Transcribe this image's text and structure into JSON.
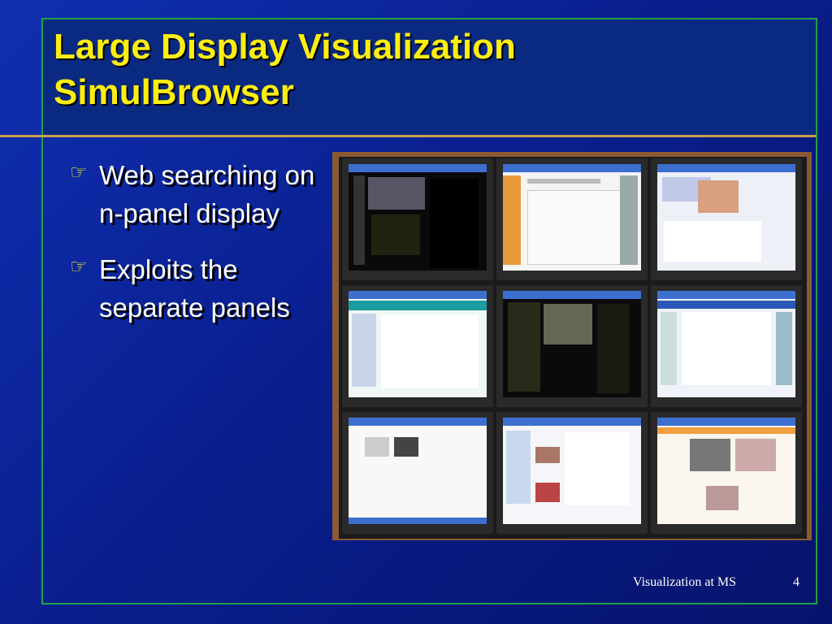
{
  "slide": {
    "title_line1": "Large Display Visualization",
    "title_line2": "SimulBrowser",
    "bullets": [
      {
        "icon": "pointing-hand-icon",
        "text": "Web searching on n-panel display"
      },
      {
        "icon": "pointing-hand-icon",
        "text": "Exploits the separate panels"
      }
    ],
    "footer": "Visualization at MS",
    "page_number": "4"
  },
  "colors": {
    "title": "#ffee10",
    "background": "#0a1f8f",
    "rule": "#c8a04a",
    "frame": "#1fa04a"
  }
}
